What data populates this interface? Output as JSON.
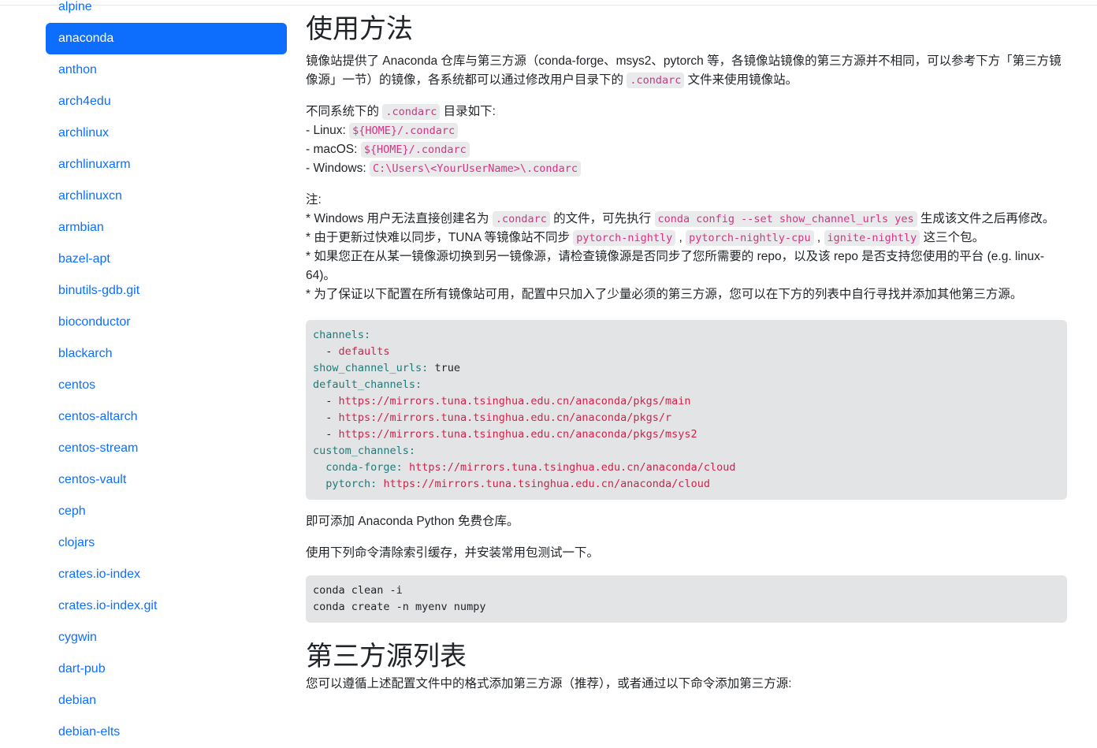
{
  "sidebar": {
    "items": [
      "alpine",
      "anaconda",
      "anthon",
      "arch4edu",
      "archlinux",
      "archlinuxarm",
      "archlinuxcn",
      "armbian",
      "bazel-apt",
      "binutils-gdb.git",
      "bioconductor",
      "blackarch",
      "centos",
      "centos-altarch",
      "centos-stream",
      "centos-vault",
      "ceph",
      "clojars",
      "crates.io-index",
      "crates.io-index.git",
      "cygwin",
      "dart-pub",
      "debian",
      "debian-elts"
    ],
    "active": "anaconda"
  },
  "main": {
    "title": "使用方法",
    "intro1": "镜像站提供了 Anaconda 仓库与第三方源（conda-forge、msys2、pytorch 等，各镜像站镜像的第三方源并不相同，可以参考下方「第三方镜像源」一节）的镜像，各系统都可以通过修改用户目录下的 ",
    "condarc": ".condarc",
    "intro2": " 文件来使用镜像站。",
    "dirs_pre": "不同系统下的 ",
    "dirs_post": " 目录如下:",
    "linux_label": "- Linux: ",
    "linux_path": "${HOME}/.condarc",
    "mac_label": "- macOS: ",
    "mac_path": "${HOME}/.condarc",
    "win_label": "- Windows: ",
    "win_path": "C:\\Users\\<YourUserName>\\.condarc",
    "note": "注:",
    "n1a": "* Windows 用户无法直接创建名为 ",
    "n1b": " 的文件，可先执行 ",
    "n1cmd": "conda config --set show_channel_urls yes",
    "n1c": " 生成该文件之后再修改。",
    "n2a": "* 由于更新过快难以同步，TUNA 等镜像站不同步 ",
    "pkg1": "pytorch-nightly",
    "pkg2": "pytorch-nightly-cpu",
    "pkg3": "ignite-nightly",
    "comma": " , ",
    "n2b": " 这三个包。",
    "n3": "* 如果您正在从某一镜像源切换到另一镜像源，请检查镜像源是否同步了您所需要的 repo，以及该 repo 是否支持您使用的平台 (e.g. linux-64)。",
    "n4": "* 为了保证以下配置在所有镜像站可用，配置中只加入了少量必须的第三方源，您可以在下方的列表中自行寻找并添加其他第三方源。",
    "config": {
      "channels": "channels:",
      "defaults": "defaults",
      "scu": "show_channel_urls:",
      "true": " true",
      "dc": "default_channels:",
      "u1": "https://mirrors.tuna.tsinghua.edu.cn/anaconda/pkgs/main",
      "u2": "https://mirrors.tuna.tsinghua.edu.cn/anaconda/pkgs/r",
      "u3": "https://mirrors.tuna.tsinghua.edu.cn/anaconda/pkgs/msys2",
      "cc": "custom_channels:",
      "cf": "conda-forge:",
      "pt": "pytorch:",
      "cloud": "https://mirrors.tuna.tsinghua.edu.cn/anaconda/cloud"
    },
    "after1": "即可添加 Anaconda Python 免费仓库。",
    "after2": "使用下列命令清除索引缓存，并安装常用包测试一下。",
    "cmd1": "conda clean -i",
    "cmd2": "conda create -n myenv numpy",
    "title2": "第三方源列表",
    "third": "您可以遵循上述配置文件中的格式添加第三方源（推荐），或者通过以下命令添加第三方源:"
  }
}
